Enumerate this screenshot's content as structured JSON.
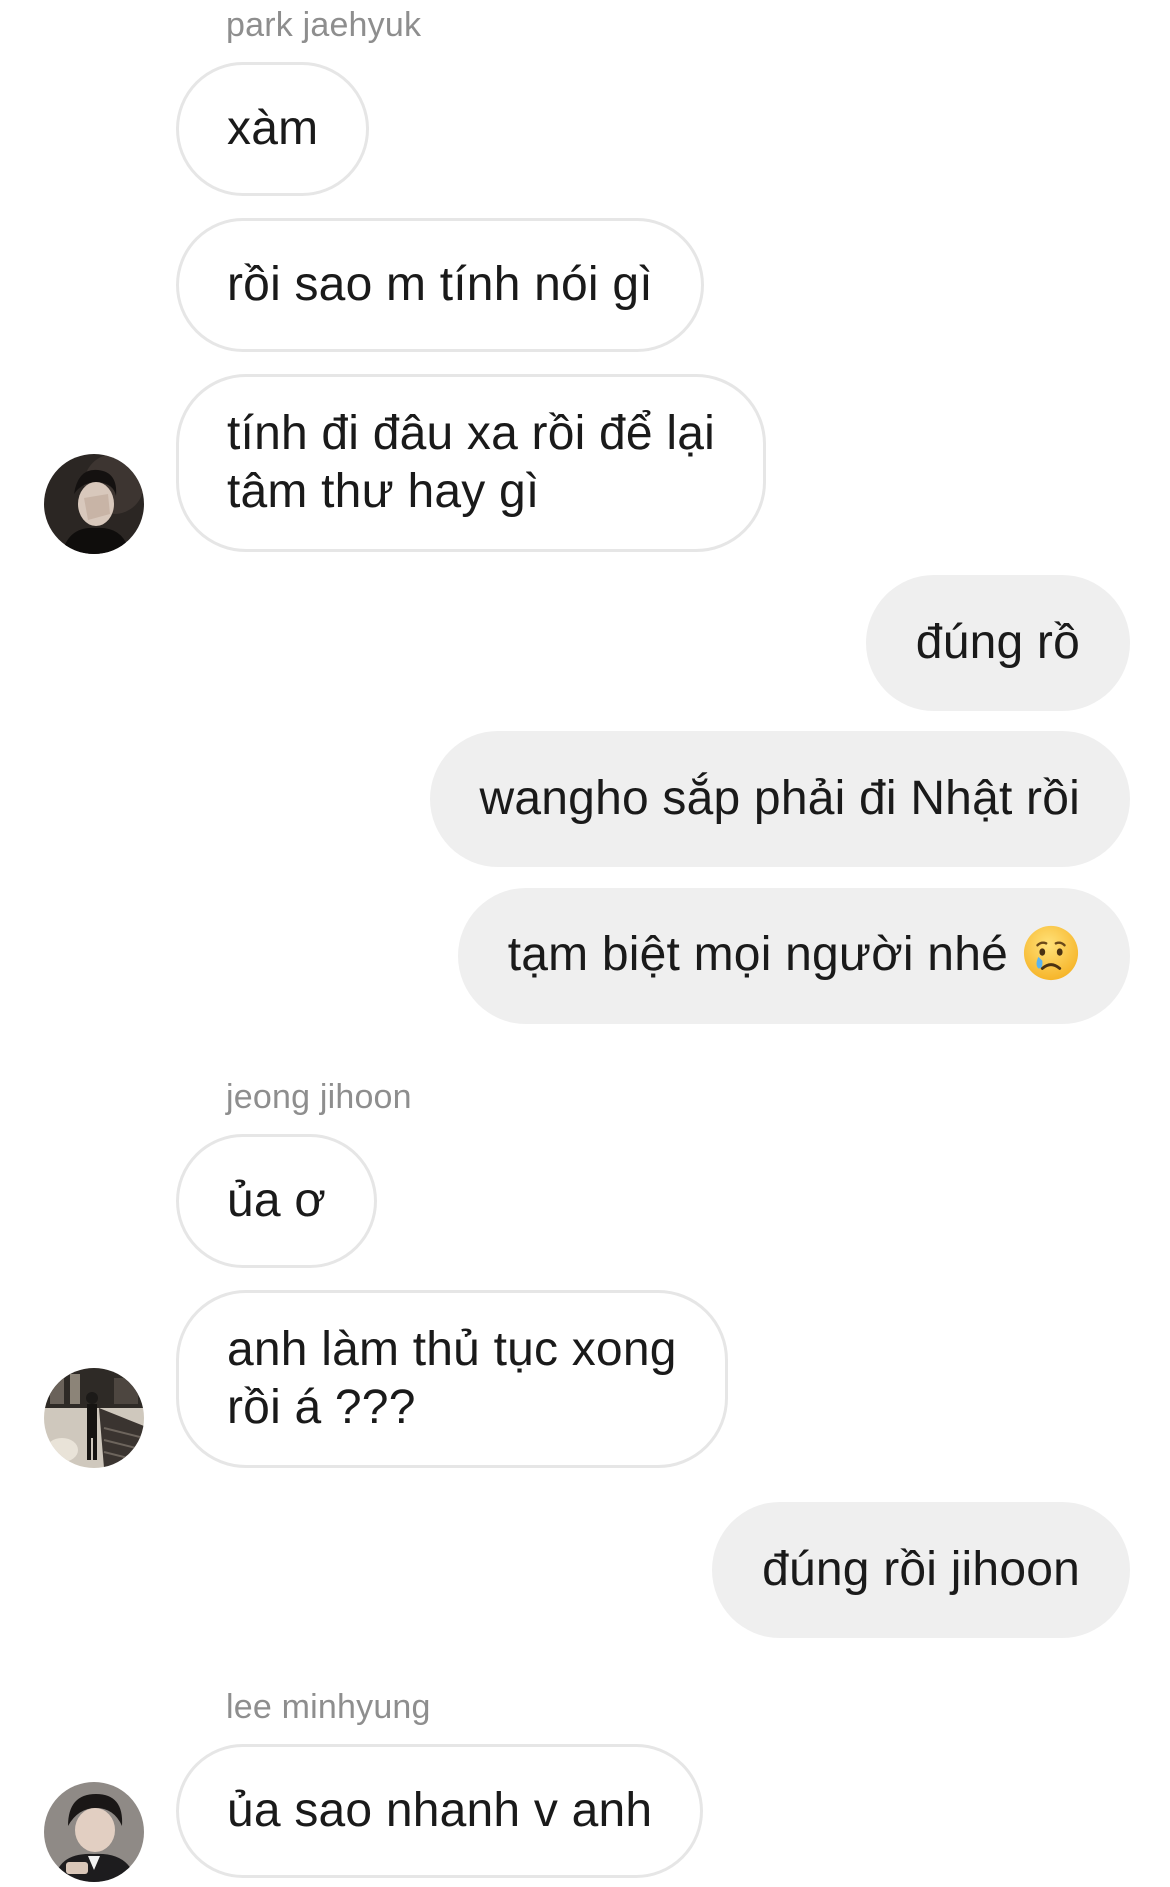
{
  "thread": {
    "groups": [
      {
        "sender": "park jaehyuk",
        "messages": [
          "xàm",
          "rồi sao m tính nói gì",
          "tính đi đâu xa rồi để lại",
          "tâm thư hay gì"
        ]
      },
      {
        "sender": "me",
        "messages": [
          "đúng rồ",
          "wangho sắp phải đi Nhật rồi",
          "tạm biệt mọi người nhé"
        ]
      },
      {
        "sender": "jeong jihoon",
        "messages": [
          "ủa ơ",
          "anh làm thủ tục xong",
          "rồi á ???"
        ]
      },
      {
        "sender": "me",
        "messages": [
          "đúng rồi jihoon"
        ]
      },
      {
        "sender": "lee minhyung",
        "messages": [
          "ủa sao nhanh v anh"
        ]
      }
    ]
  },
  "icons": {
    "crying_emoji": "crying-face-emoji"
  },
  "colors": {
    "incoming_bubble_border": "#e6e6e6",
    "outgoing_bubble_bg": "#efefef",
    "sender_name": "#8e8e8e",
    "text": "#1a1a1a"
  }
}
